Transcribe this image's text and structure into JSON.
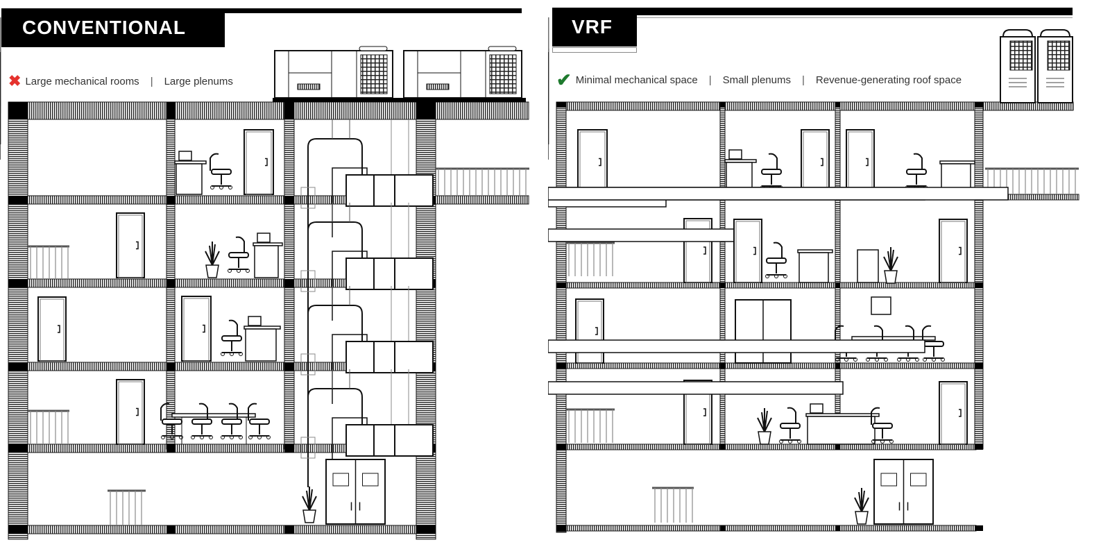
{
  "conventional": {
    "title": "CONVENTIONAL",
    "status_icon": "cross-icon",
    "status_color": "#e5322d",
    "features": [
      "Large mechanical rooms",
      "Large plenums"
    ],
    "separator": "|",
    "floors": 5,
    "rooftop_units": 2
  },
  "vrf": {
    "title": "VRF",
    "status_icon": "check-icon",
    "status_color": "#1e7a2e",
    "features": [
      "Minimal mechanical space",
      "Small plenums",
      "Revenue-generating roof space"
    ],
    "separator": "|",
    "floors": 5,
    "rooftop_units": 2
  }
}
